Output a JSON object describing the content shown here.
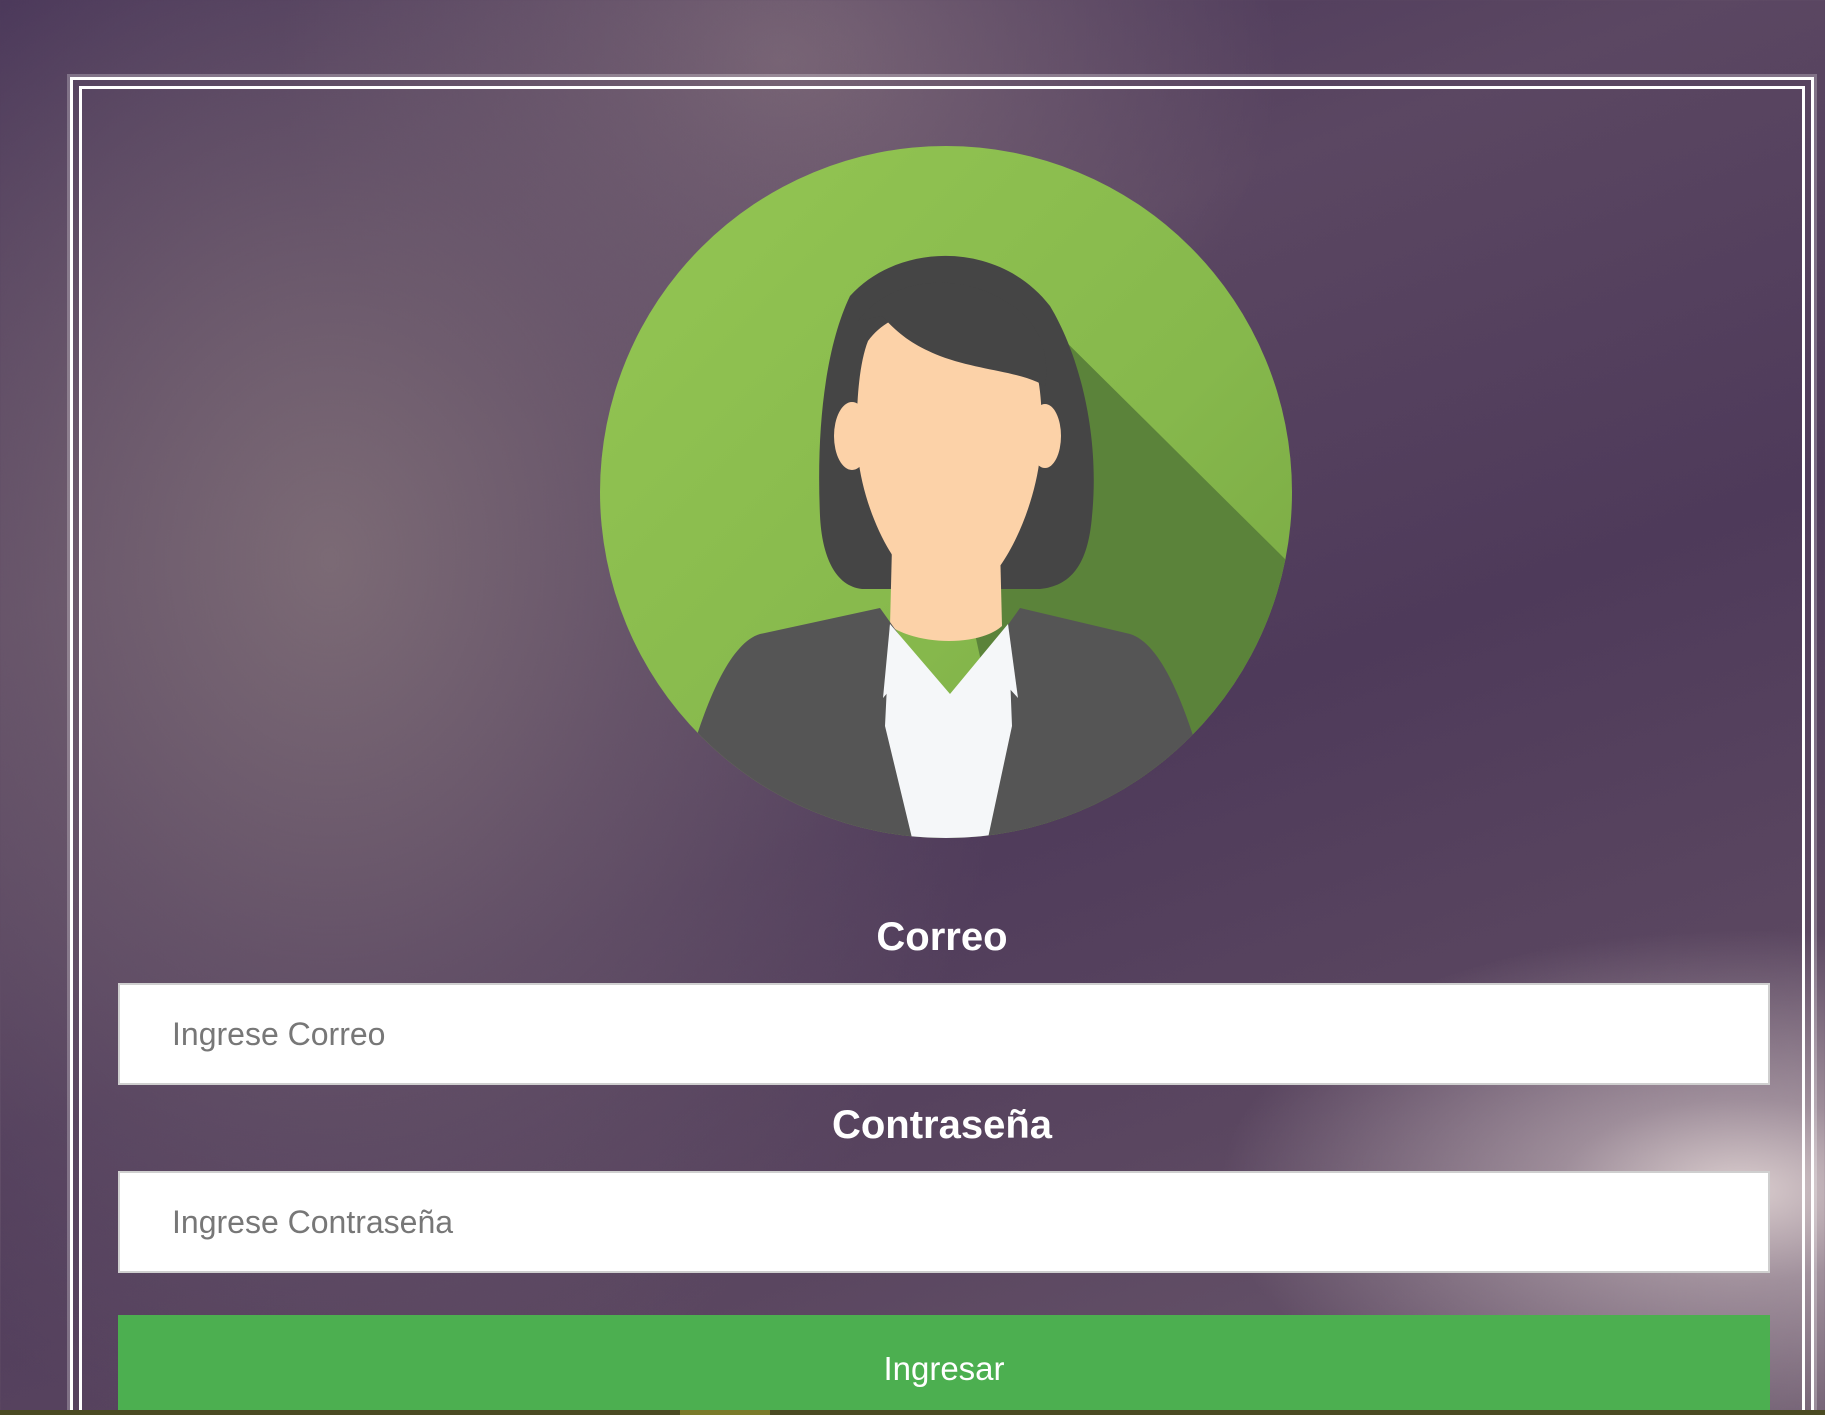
{
  "login": {
    "email_label": "Correo",
    "email_placeholder": "Ingrese Correo",
    "password_label": "Contraseña",
    "password_placeholder": "Ingrese Contraseña",
    "submit_label": "Ingresar"
  },
  "avatar": {
    "icon": "businesswoman-avatar-icon"
  },
  "colors": {
    "button": "#4caf50",
    "avatar_circle": "#8bc34a",
    "frame": "#ffffff"
  }
}
